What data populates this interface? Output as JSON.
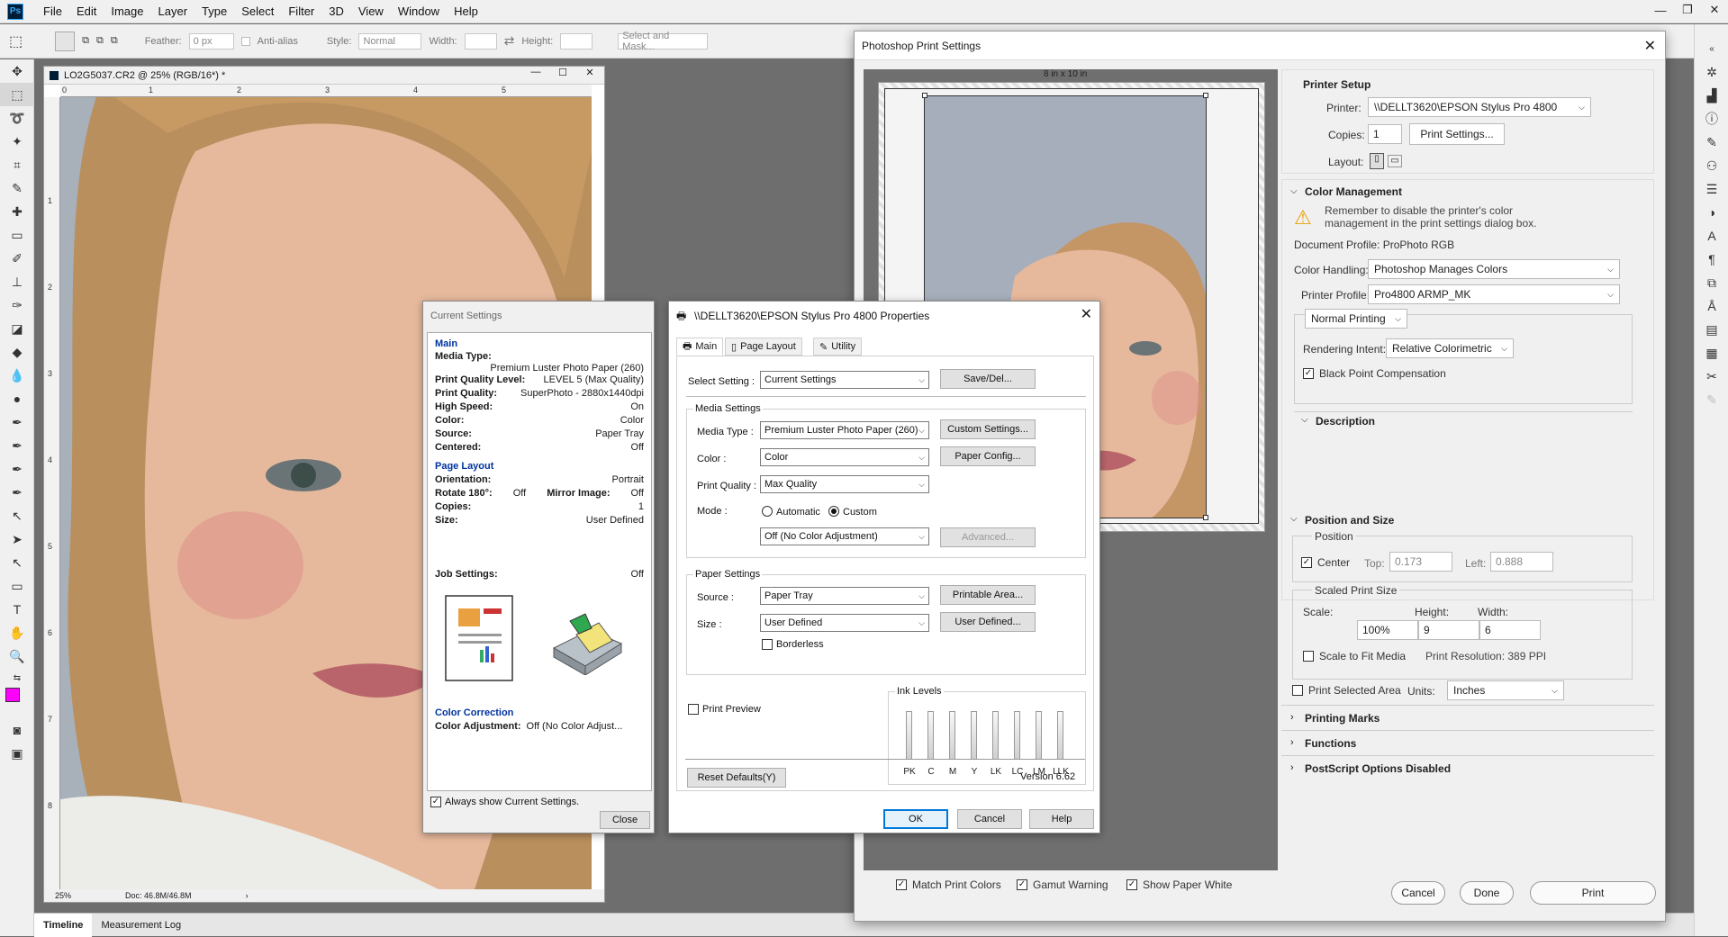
{
  "menubar": {
    "logo": "Ps",
    "items": [
      "File",
      "Edit",
      "Image",
      "Layer",
      "Type",
      "Select",
      "Filter",
      "3D",
      "View",
      "Window",
      "Help"
    ]
  },
  "options": {
    "feather_label": "Feather:",
    "feather_value": "0 px",
    "antialias_label": "Anti-alias",
    "style_label": "Style:",
    "style_value": "Normal",
    "width_label": "Width:",
    "height_label": "Height:",
    "select_mask": "Select and Mask..."
  },
  "document": {
    "title": "LO2G5037.CR2 @ 25% (RGB/16*) *",
    "zoom": "25%",
    "doc_size": "Doc: 46.8M/46.8M",
    "ruler_h": [
      "0",
      "1",
      "2",
      "3",
      "4",
      "5"
    ],
    "ruler_v": [
      "1",
      "2",
      "3",
      "4",
      "5",
      "6",
      "7",
      "8"
    ]
  },
  "bottom_tabs": [
    "Timeline",
    "Measurement Log"
  ],
  "print_dialog": {
    "title": "Photoshop Print Settings",
    "paper_size": "8 in x 10 in",
    "printer_setup": {
      "heading": "Printer Setup",
      "printer_label": "Printer:",
      "printer_value": "\\\\DELLT3620\\EPSON Stylus Pro 4800",
      "copies_label": "Copies:",
      "copies_value": "1",
      "print_settings_btn": "Print Settings...",
      "layout_label": "Layout:"
    },
    "color_management": {
      "heading": "Color Management",
      "warning": "Remember to disable the printer's color management in the print settings dialog box.",
      "doc_profile": "Document Profile: ProPhoto RGB",
      "handling_label": "Color Handling:",
      "handling_value": "Photoshop Manages Colors",
      "profile_label": "Printer Profile:",
      "profile_value": "Pro4800 ARMP_MK",
      "normal_printing": "Normal Printing",
      "intent_label": "Rendering Intent:",
      "intent_value": "Relative Colorimetric",
      "bpc_label": "Black Point Compensation"
    },
    "description_heading": "Description",
    "position_size": {
      "heading": "Position and Size",
      "position_label": "Position",
      "center_label": "Center",
      "top_label": "Top:",
      "top_value": "0.173",
      "left_label": "Left:",
      "left_value": "0.888",
      "scaled_label": "Scaled Print Size",
      "scale_label": "Scale:",
      "scale_value": "100%",
      "height_label": "Height:",
      "height_value": "9",
      "width_label": "Width:",
      "width_value": "6",
      "fit_label": "Scale to Fit Media",
      "resolution": "Print Resolution: 389 PPI",
      "selected_area": "Print Selected Area",
      "units_label": "Units:",
      "units_value": "Inches"
    },
    "collapsed_sections": [
      "Printing Marks",
      "Functions",
      "PostScript Options Disabled"
    ],
    "match_colors": "Match Print Colors",
    "gamut_warning": "Gamut Warning",
    "paper_white": "Show Paper White",
    "cancel": "Cancel",
    "done": "Done",
    "print": "Print"
  },
  "current_settings": {
    "title": "Current Settings",
    "main_heading": "Main",
    "media_type_label": "Media Type:",
    "media_type_value": "Premium Luster Photo Paper (260)",
    "rows_main": [
      {
        "k": "Print Quality Level:",
        "v": "LEVEL 5 (Max Quality)"
      },
      {
        "k": "Print Quality:",
        "v": "SuperPhoto - 2880x1440dpi"
      },
      {
        "k": "High Speed:",
        "v": "On"
      },
      {
        "k": "Color:",
        "v": "Color"
      },
      {
        "k": "Source:",
        "v": "Paper Tray"
      },
      {
        "k": "Centered:",
        "v": "Off"
      }
    ],
    "layout_heading": "Page Layout",
    "orientation_label": "Orientation:",
    "orientation_value": "Portrait",
    "rotate_label": "Rotate 180°:",
    "rotate_value": "Off",
    "mirror_label": "Mirror Image:",
    "mirror_value": "Off",
    "copies_label": "Copies:",
    "copies_value": "1",
    "size_label": "Size:",
    "size_value": "User Defined",
    "job_label": "Job Settings:",
    "job_value": "Off",
    "correction_heading": "Color Correction",
    "adjust_label": "Color Adjustment:",
    "adjust_value": "Off (No Color Adjust...",
    "always_show": "Always show Current Settings.",
    "close": "Close"
  },
  "epson": {
    "title": "\\\\DELLT3620\\EPSON Stylus Pro 4800 Properties",
    "tabs": [
      "Main",
      "Page Layout",
      "Utility"
    ],
    "select_setting_label": "Select Setting :",
    "select_setting_value": "Current Settings",
    "save_del": "Save/Del...",
    "media_settings": "Media Settings",
    "media_type_label": "Media Type :",
    "media_type_value": "Premium Luster Photo Paper (260)",
    "custom_settings": "Custom Settings...",
    "color_label": "Color :",
    "color_value": "Color",
    "paper_config": "Paper Config...",
    "quality_label": "Print Quality :",
    "quality_value": "Max Quality",
    "mode_label": "Mode :",
    "mode_auto": "Automatic",
    "mode_custom": "Custom",
    "mode_value": "Off (No Color Adjustment)",
    "advanced": "Advanced...",
    "paper_settings": "Paper Settings",
    "source_label": "Source :",
    "source_value": "Paper Tray",
    "printable_area": "Printable Area...",
    "size_label": "Size :",
    "size_value": "User Defined",
    "user_defined_btn": "User Defined...",
    "borderless": "Borderless",
    "print_preview": "Print Preview",
    "ink_levels": "Ink Levels",
    "inks": [
      "PK",
      "C",
      "M",
      "Y",
      "LK",
      "LC",
      "LM",
      "LLK"
    ],
    "reset": "Reset Defaults(Y)",
    "version": "Version 6.62",
    "ok": "OK",
    "cancel": "Cancel",
    "help": "Help"
  }
}
